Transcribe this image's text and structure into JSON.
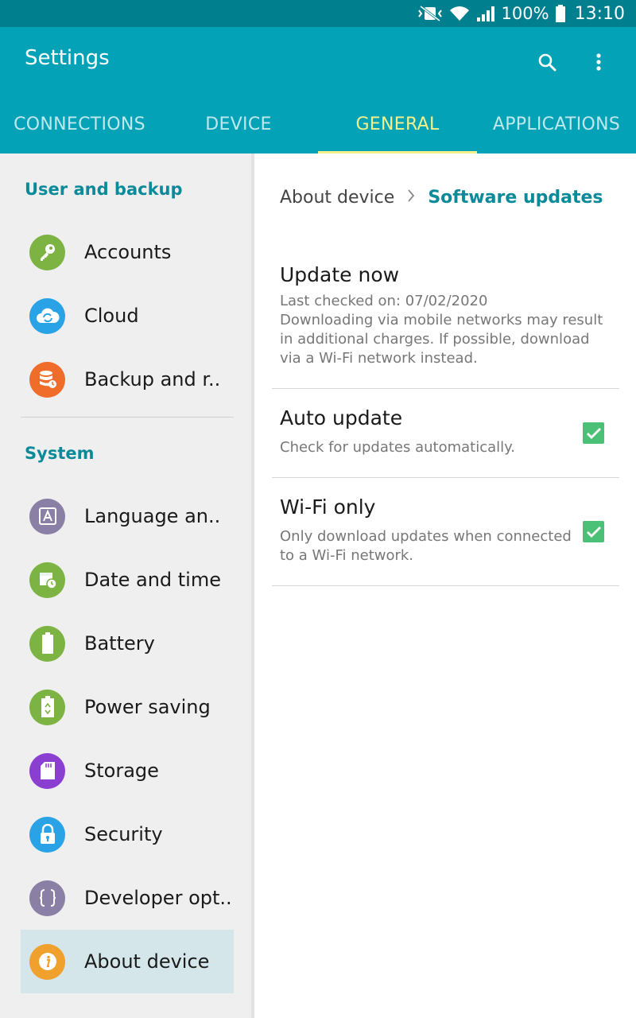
{
  "status_bar": {
    "battery": "100%",
    "time": "13:10"
  },
  "app_bar": {
    "title": "Settings",
    "search_icon": "search-icon",
    "more_icon": "more-vert-icon"
  },
  "tabs": [
    {
      "label": "CONNECTIONS",
      "active": false
    },
    {
      "label": "DEVICE",
      "active": false
    },
    {
      "label": "GENERAL",
      "active": true
    },
    {
      "label": "APPLICATIONS",
      "active": false
    }
  ],
  "sidebar": {
    "sections": [
      {
        "header": "User and backup"
      },
      {
        "header": "System"
      }
    ],
    "items": [
      {
        "label": "Accounts",
        "icon": "key-icon",
        "color": "#7cb342"
      },
      {
        "label": "Cloud",
        "icon": "cloud-sync-icon",
        "color": "#29a3e6"
      },
      {
        "label": "Backup and r..",
        "icon": "backup-icon",
        "color": "#ef6c2b"
      },
      {
        "label": "Language an..",
        "icon": "language-icon",
        "color": "#8a7fa4"
      },
      {
        "label": "Date and time",
        "icon": "calendar-clock-icon",
        "color": "#7cb342"
      },
      {
        "label": "Battery",
        "icon": "battery-icon",
        "color": "#7cb342"
      },
      {
        "label": "Power saving",
        "icon": "recycle-icon",
        "color": "#7cb342"
      },
      {
        "label": "Storage",
        "icon": "sd-card-icon",
        "color": "#8a3fd1"
      },
      {
        "label": "Security",
        "icon": "lock-icon",
        "color": "#29a3e6"
      },
      {
        "label": "Developer opt..",
        "icon": "braces-icon",
        "color": "#8a7fa4"
      },
      {
        "label": "About device",
        "icon": "info-icon",
        "color": "#f0a02c",
        "selected": true
      }
    ]
  },
  "content": {
    "breadcrumb": {
      "parent": "About device",
      "current": "Software updates"
    },
    "prefs": [
      {
        "title": "Update now",
        "summary": "Last checked on: 07/02/2020\nDownloading via mobile networks may result in additional charges. If possible, download via a Wi-Fi network instead."
      },
      {
        "title": "Auto update",
        "summary": "Check for updates automatically.",
        "checked": true
      },
      {
        "title": "Wi-Fi only",
        "summary": "Only download updates when connected to a Wi-Fi network.",
        "checked": true
      }
    ],
    "update_now_lines": [
      "Last checked on: 07/02/2020",
      "Downloading via mobile networks may result",
      "in additional charges. If possible, download",
      "via a Wi-Fi network instead."
    ],
    "wifi_only_lines": [
      "Only download updates when connected",
      "to a Wi-Fi network."
    ]
  },
  "colors": {
    "status_bar": "#007f8f",
    "app_bar": "#03a2b7",
    "active_tab": "#f4f18a",
    "accent_text": "#0b8a99",
    "checkbox": "#4bc077",
    "selected_item_bg": "#d4e6e9"
  }
}
